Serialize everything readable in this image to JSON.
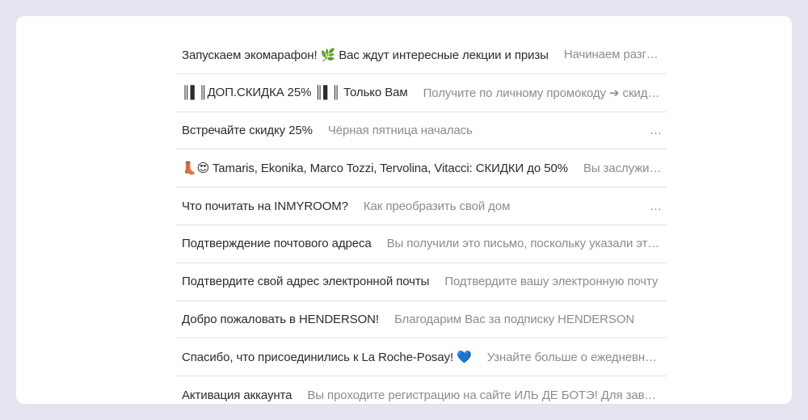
{
  "emails": [
    {
      "subject": "Запускаем экомарафон! 🌿 Вас ждут интересные лекции и призы",
      "preview": "Начинаем разговор о том, как заботиться о планете"
    },
    {
      "subject": "║▌║ДОП.СКИДКА 25% ║▌║ Только Вам",
      "preview": "Получите по личному промокоду ➔ скидку на всё"
    },
    {
      "subject": "Встречайте скидку 25%",
      "preview": "Чёрная пятница началась",
      "trailing": "…"
    },
    {
      "subject": "👢😍 Tamaris, Ekonika, Marco Tozzi, Tervolina, Vitacci: СКИДКИ до 50%",
      "preview": "Вы заслужили это"
    },
    {
      "subject": "Что почитать на INMYROOM?",
      "preview": "Как преобразить свой дом",
      "trailing": "…"
    },
    {
      "subject": "Подтверждение почтового адреса",
      "preview": "Вы получили это письмо, поскольку указали этот адрес"
    },
    {
      "subject": "Подтвердите свой адрес электронной почты",
      "preview": "Подтвердите вашу электронную почту"
    },
    {
      "subject": "Добро пожаловать в HENDERSON!",
      "preview": "Благодарим Вас за подписку HENDERSON"
    },
    {
      "subject": "Спасибо, что присоединились к La Roche-Posay! 💙",
      "preview": "Узнайте больше о ежедневном уходе"
    },
    {
      "subject": "Активация аккаунта",
      "preview": "Вы проходите регистрацию на сайте ИЛЬ ДЕ БОТЭ! Для завершения"
    }
  ]
}
